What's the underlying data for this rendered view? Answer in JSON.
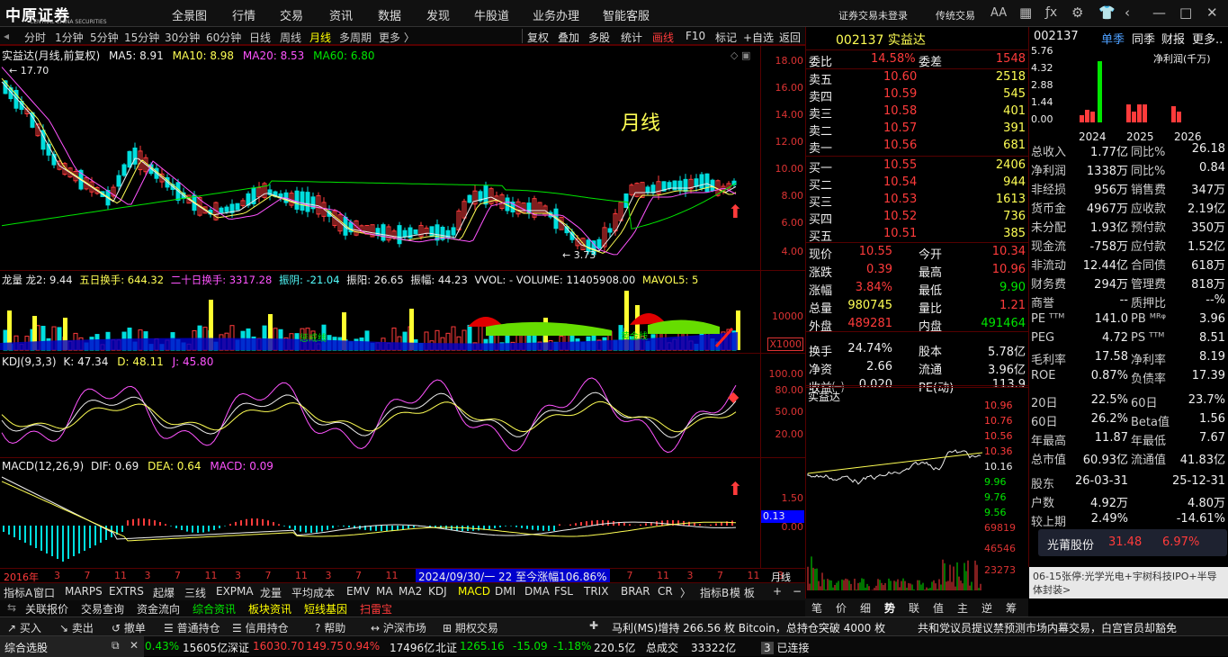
{
  "brand": {
    "name": "中原证券",
    "sub": "CENTRAL CHINA SECURITIES"
  },
  "menu": [
    "全景图",
    "行情",
    "交易",
    "资讯",
    "数据",
    "发现",
    "牛股道",
    "业务办理",
    "智能客服"
  ],
  "topright": {
    "login": "证券交易未登录",
    "trade": "传统交易"
  },
  "periods": [
    "分时",
    "1分钟",
    "5分钟",
    "15分钟",
    "30分钟",
    "60分钟",
    "日线",
    "周线",
    "月线",
    "多周期",
    "更多 〉"
  ],
  "active_period": "月线",
  "toolright": [
    "复权",
    "叠加",
    "多股",
    "统计",
    "画线",
    "F10",
    "标记",
    "+自选",
    "返回"
  ],
  "stock": {
    "code": "002137",
    "name": "实益达"
  },
  "main_panel": {
    "title": "实益达(月线,前复权)",
    "ma5": "MA5: 8.91",
    "ma10": "MA10: 8.98",
    "ma20": "MA20: 8.53",
    "ma60": "MA60: 6.80",
    "annotation": "月线",
    "high_label": "17.70",
    "low_label": "3.73",
    "axis": [
      "18.00",
      "16.00",
      "14.00",
      "12.00",
      "10.00",
      "8.00",
      "6.00",
      "4.00"
    ]
  },
  "vol_panel": {
    "name": "龙量",
    "dragon2": "龙2: 9.44",
    "h5": "五日换手: 644.32",
    "h20": "二十日换手: 3317.28",
    "zhenyin": "振阴: -21.04",
    "zhenyang": "振阳: 26.65",
    "zhenfu": "振幅: 44.23",
    "vvol": "VVOL: - VOLUME: 11405908.00",
    "mavol": "MAVOL5: 5",
    "axis": "10000",
    "unit": "X1000",
    "tag1": "惩戒线",
    "tag2": "黄金线"
  },
  "kdj_panel": {
    "title": "KDJ(9,3,3)",
    "k": "K: 47.34",
    "d": "D: 48.11",
    "j": "J: 45.80",
    "axis": [
      "100.00",
      "80.00",
      "50.00",
      "20.00"
    ]
  },
  "macd_panel": {
    "title": "MACD(12,26,9)",
    "dif": "DIF: 0.69",
    "dea": "DEA: 0.64",
    "macd": "MACD: 0.09",
    "axis": [
      "1.50",
      "0.00"
    ],
    "badge": "0.13"
  },
  "timeline": {
    "year": "2016年",
    "marks": [
      "3",
      "7",
      "11",
      "3",
      "7",
      "11",
      "3",
      "7",
      "11",
      "3",
      "7",
      "11",
      "3",
      "7",
      "11",
      "3",
      "7",
      "11",
      "3",
      "7",
      "11",
      "3",
      "7",
      "11",
      "3"
    ],
    "range": "2024/09/30/一 22 至今涨幅106.86%",
    "period": "月线"
  },
  "quote": {
    "title": "002137 实益达",
    "webi": "14.58%",
    "wecha": "1548",
    "sell": [
      [
        "卖五",
        "10.60",
        "2518"
      ],
      [
        "卖四",
        "10.59",
        "545"
      ],
      [
        "卖三",
        "10.58",
        "401"
      ],
      [
        "卖二",
        "10.57",
        "391"
      ],
      [
        "卖一",
        "10.56",
        "681"
      ]
    ],
    "buy": [
      [
        "买一",
        "10.55",
        "2406"
      ],
      [
        "买二",
        "10.54",
        "944"
      ],
      [
        "买三",
        "10.53",
        "1613"
      ],
      [
        "买四",
        "10.52",
        "736"
      ],
      [
        "买五",
        "10.51",
        "385"
      ]
    ],
    "stats": [
      [
        "现价",
        "10.55",
        "今开",
        "10.34"
      ],
      [
        "涨跌",
        "0.39",
        "最高",
        "10.96"
      ],
      [
        "涨幅",
        "3.84%",
        "最低",
        "9.90"
      ],
      [
        "总量",
        "980745",
        "量比",
        "1.21"
      ],
      [
        "外盘",
        "489281",
        "内盘",
        "491464"
      ],
      [
        "换手",
        "24.74%",
        "股本",
        "5.78亿"
      ],
      [
        "净资",
        "2.66",
        "流通",
        "3.96亿"
      ],
      [
        "收益㈠",
        "0.020",
        "PE(动)",
        "113.9"
      ]
    ],
    "mini_title": "实益达",
    "mini_axis": [
      "10.96",
      "10.76",
      "10.56",
      "10.36",
      "10.16",
      "9.96",
      "9.76",
      "9.56",
      "69819",
      "46546",
      "23273"
    ]
  },
  "fin": {
    "code": "002137",
    "tabs": [
      "单季",
      "同季",
      "财报",
      "更多.."
    ],
    "chart_axis": [
      "5.76",
      "4.32",
      "2.88",
      "1.44",
      "0.00"
    ],
    "chart_years": [
      "2024",
      "2025",
      "2026"
    ],
    "chart_label": "净利润(千万)",
    "rows": [
      [
        "总收入",
        "1.77亿",
        "同比%",
        "26.18"
      ],
      [
        "净利润",
        "1338万",
        "同比%",
        "0.84"
      ],
      [
        "非经损",
        "956万",
        "销售费",
        "347万"
      ],
      [
        "货币金",
        "4967万",
        "应收款",
        "2.19亿"
      ],
      [
        "未分配",
        "1.93亿",
        "预付款",
        "350万"
      ],
      [
        "现金流",
        "-758万",
        "应付款",
        "1.52亿"
      ],
      [
        "非流动",
        "12.44亿",
        "合同债",
        "618万"
      ],
      [
        "财务费",
        "294万",
        "管理费",
        "818万"
      ],
      [
        "商誉",
        "--",
        "质押比",
        "--%"
      ],
      [
        "PE ᵀᵀᴹ",
        "141.0",
        "PB ᴹᴿᵠ",
        "3.96"
      ],
      [
        "PEG",
        "4.72",
        "PS ᵀᵀᴹ",
        "8.51"
      ],
      [
        "毛利率",
        "17.58",
        "净利率",
        "8.19"
      ],
      [
        "ROE",
        "0.87%",
        "负债率",
        "17.39"
      ],
      [
        "20日",
        "22.5%",
        "60日",
        "23.7%"
      ],
      [
        "60日",
        "26.2%",
        "Beta值",
        "1.56"
      ],
      [
        "年最高",
        "11.87",
        "年最低",
        "7.67"
      ],
      [
        "总市值",
        "60.93亿",
        "流通值",
        "41.83亿"
      ],
      [
        "股东",
        "26-03-31",
        "",
        "25-12-31"
      ],
      [
        "户数",
        "4.92万",
        "",
        "4.80万"
      ],
      [
        "较上期",
        "2.49%",
        "",
        "-14.61%"
      ]
    ],
    "popup_name": "光莆股份",
    "popup_price": "31.48",
    "popup_pct": "6.97%",
    "news": "06-15张停:光学光电+宇树科技IPO+半导体封装>"
  },
  "indicator_tabs": [
    "指标A",
    "窗口",
    "MARPS",
    "EXTRS",
    "起爆",
    "三线",
    "EXPMA",
    "龙量",
    "平均成本",
    "EMV",
    "MA",
    "MA2",
    "KDJ",
    "MACD",
    "DMI",
    "DMA",
    "FSL",
    "TRIX",
    "BRAR",
    "CR",
    "〉",
    "指标B",
    "模 板",
    "+",
    "−"
  ],
  "sub_tabs": [
    "关联报价",
    "交易查询",
    "资金流向",
    "综合资讯",
    "板块资讯",
    "短线基因",
    "扫雷宝"
  ],
  "right_tabs": [
    "笔",
    "价",
    "细",
    "势",
    "联",
    "值",
    "主",
    "逆",
    "筹"
  ],
  "tradebar": [
    "买入",
    "卖出",
    "撤单",
    "普通持仓",
    "信用持仓",
    "帮助",
    "沪深市场",
    "期权交易"
  ],
  "ticker": "马利(MS)增持 266.56 枚 Bitcoin，总持仓突破 4000 枚",
  "ticker2": "共和党议员提议禁预测市场内幕交易，白宫官员却豁免",
  "status": {
    "select": "综合选股",
    "pct1": "0.43%",
    "v1": "15605亿",
    "sz": "深证",
    "sz_v": "16030.70",
    "sz_c": "149.75",
    "sz_p": "0.94%",
    "v2": "17496亿",
    "bz": "北证",
    "bz_v": "1265.16",
    "bz_c": "-15.09",
    "bz_p": "-1.18%",
    "v3": "220.5亿",
    "deal": "总成交",
    "deal_v": "33322亿",
    "conn": "已连接"
  }
}
